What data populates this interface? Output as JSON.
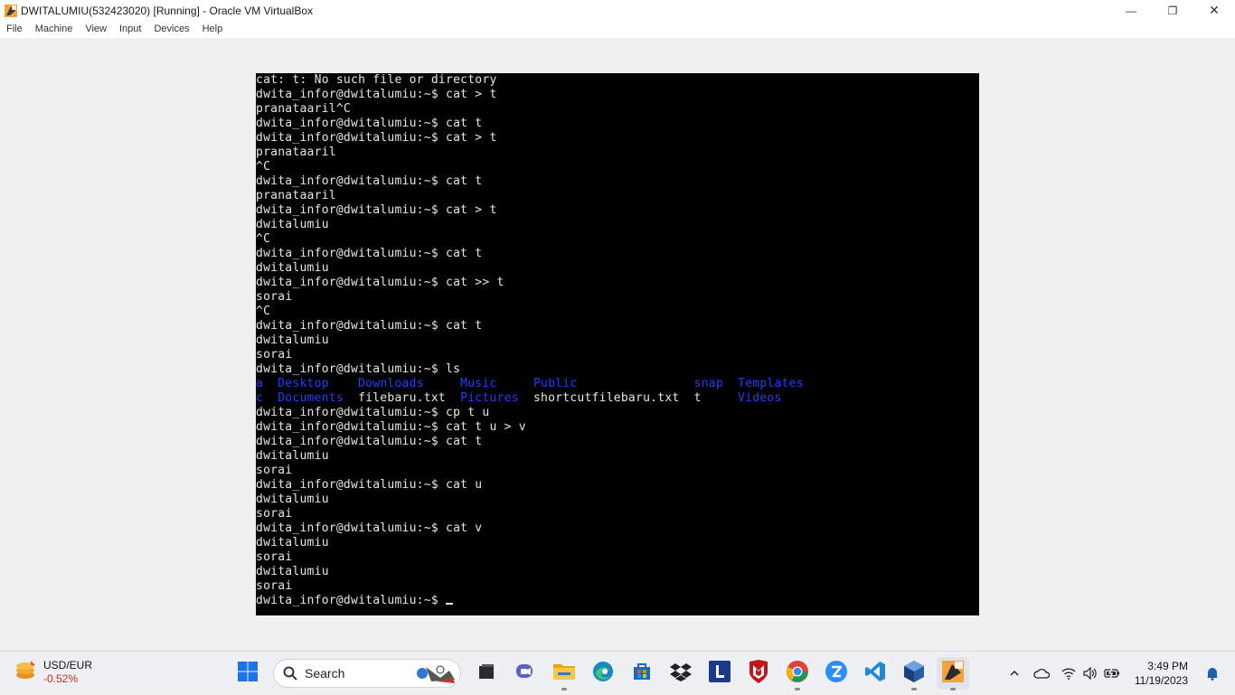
{
  "window": {
    "title": "DWITALUMIU(532423020) [Running] - Oracle VM VirtualBox",
    "minimize_glyph": "—",
    "restore_glyph": "❐",
    "close_glyph": "✕"
  },
  "menu": [
    "File",
    "Machine",
    "View",
    "Input",
    "Devices",
    "Help"
  ],
  "terminal": {
    "lines": [
      "cat: t: No such file or directory",
      "dwita_infor@dwitalumiu:~$ cat > t",
      "pranataaril^C",
      "dwita_infor@dwitalumiu:~$ cat t",
      "dwita_infor@dwitalumiu:~$ cat > t",
      "pranataaril",
      "^C",
      "dwita_infor@dwitalumiu:~$ cat t",
      "pranataaril",
      "dwita_infor@dwitalumiu:~$ cat > t",
      "dwitalumiu",
      "^C",
      "dwita_infor@dwitalumiu:~$ cat t",
      "dwitalumiu",
      "dwita_infor@dwitalumiu:~$ cat >> t",
      "sorai",
      "^C",
      "dwita_infor@dwitalumiu:~$ cat t",
      "dwitalumiu",
      "sorai",
      "dwita_infor@dwitalumiu:~$ ls"
    ],
    "ls_rows": [
      [
        {
          "text": "a  ",
          "dir": true
        },
        {
          "text": "Desktop    ",
          "dir": true
        },
        {
          "text": "Downloads     ",
          "dir": true
        },
        {
          "text": "Music     ",
          "dir": true
        },
        {
          "text": "Public                ",
          "dir": true
        },
        {
          "text": "snap  ",
          "dir": true
        },
        {
          "text": "Templates",
          "dir": true
        }
      ],
      [
        {
          "text": "c  ",
          "dir": true
        },
        {
          "text": "Documents  ",
          "dir": true
        },
        {
          "text": "filebaru.txt  ",
          "dir": false
        },
        {
          "text": "Pictures  ",
          "dir": true
        },
        {
          "text": "shortcutfilebaru.txt  ",
          "dir": false
        },
        {
          "text": "t     ",
          "dir": false
        },
        {
          "text": "Videos",
          "dir": true
        }
      ]
    ],
    "lines_after": [
      "dwita_infor@dwitalumiu:~$ cp t u",
      "dwita_infor@dwitalumiu:~$ cat t u > v",
      "dwita_infor@dwitalumiu:~$ cat t",
      "dwitalumiu",
      "sorai",
      "dwita_infor@dwitalumiu:~$ cat u",
      "dwitalumiu",
      "sorai",
      "dwita_infor@dwitalumiu:~$ cat v",
      "dwitalumiu",
      "sorai",
      "dwitalumiu",
      "sorai"
    ],
    "prompt": "dwita_infor@dwitalumiu:~$ "
  },
  "taskbar": {
    "widget": {
      "title": "USD/EUR",
      "value": "-0.52%"
    },
    "search_label": "Search",
    "clock": {
      "time": "3:49 PM",
      "date": "11/19/2023"
    },
    "pinned": [
      "start-icon",
      "file-manager-icon",
      "chat-icon",
      "folder-icon",
      "edge-icon",
      "store-icon",
      "dropbox-icon",
      "launcher-l-icon",
      "mcafee-icon",
      "chrome-icon",
      "zoom-icon",
      "vscode-icon",
      "virtualbox-icon",
      "virtualbox-vm-icon"
    ]
  },
  "colors": {
    "terminal_bg": "#000000",
    "terminal_fg": "#e6e6e6",
    "dir_blue": "#1f3fff",
    "negative": "#c42b1c"
  }
}
